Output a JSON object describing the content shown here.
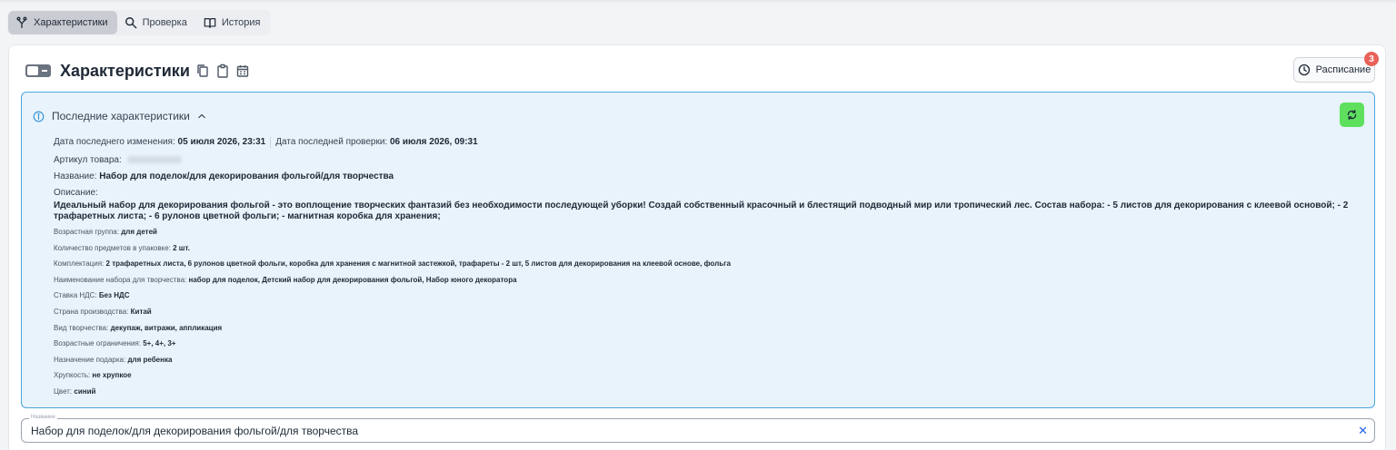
{
  "tabs": [
    {
      "label": "Характеристики",
      "icon": "fork-icon",
      "active": true
    },
    {
      "label": "Проверка",
      "icon": "search-icon",
      "active": false
    },
    {
      "label": "История",
      "icon": "book-icon",
      "active": false
    }
  ],
  "header": {
    "title": "Характеристики",
    "schedule_label": "Расписание",
    "schedule_badge": "3"
  },
  "info": {
    "title": "Последние характеристики",
    "changed_label": "Дата последнего изменения:",
    "changed_value": "05 июля 2026, 23:31",
    "checked_label": "Дата последней проверки:",
    "checked_value": "06 июля 2026, 09:31",
    "sku_label": "Артикул товара:",
    "name_label": "Название:",
    "name_value": "Набор для поделок/для декорирования фольгой/для творчества",
    "desc_label": "Описание:",
    "desc_value": "Идеальный набор для декорирования фольгой - это воплощение творческих фантазий без необходимости последующей уборки! Создай собственный красочный и блестящий подводный мир или тропический лес. Состав набора: - 5 листов для декорирования с клеевой основой; - 2 трафаретных листа; - 6 рулонов цветной фольги; - магнитная коробка для хранения;",
    "attributes": [
      {
        "label": "Возрастная группа:",
        "value": "для детей"
      },
      {
        "label": "Количество предметов в упаковке:",
        "value": "2 шт."
      },
      {
        "label": "Комплектация:",
        "value": "2 трафаретных листа, 6 рулонов цветной фольги, коробка для хранения с магнитной застежкой, трафареты - 2 шт, 5 листов для декорирования на клеевой основе, фольга"
      },
      {
        "label": "Наименование набора для творчества:",
        "value": "набор для поделок, Детский набор для декорирования фольгой, Набор юного декоратора"
      },
      {
        "label": "Ставка НДС:",
        "value": "Без НДС"
      },
      {
        "label": "Страна производства:",
        "value": "Китай"
      },
      {
        "label": "Вид творчества:",
        "value": "декупаж, витражи, аппликация"
      },
      {
        "label": "Возрастные ограничения:",
        "value": "5+, 4+, 3+"
      },
      {
        "label": "Назначение подарка:",
        "value": "для ребенка"
      },
      {
        "label": "Хрупкость:",
        "value": "не хрупкое"
      },
      {
        "label": "Цвет:",
        "value": "синий"
      }
    ]
  },
  "name_field": {
    "label": "Название",
    "value": "Набор для поделок/для декорирования фольгой/для творчества"
  },
  "colors": {
    "panel_bg": "#e8f3fb",
    "panel_border": "#4aa6dd",
    "refresh_bg": "#5ee05e",
    "badge_bg": "#e8625a"
  }
}
